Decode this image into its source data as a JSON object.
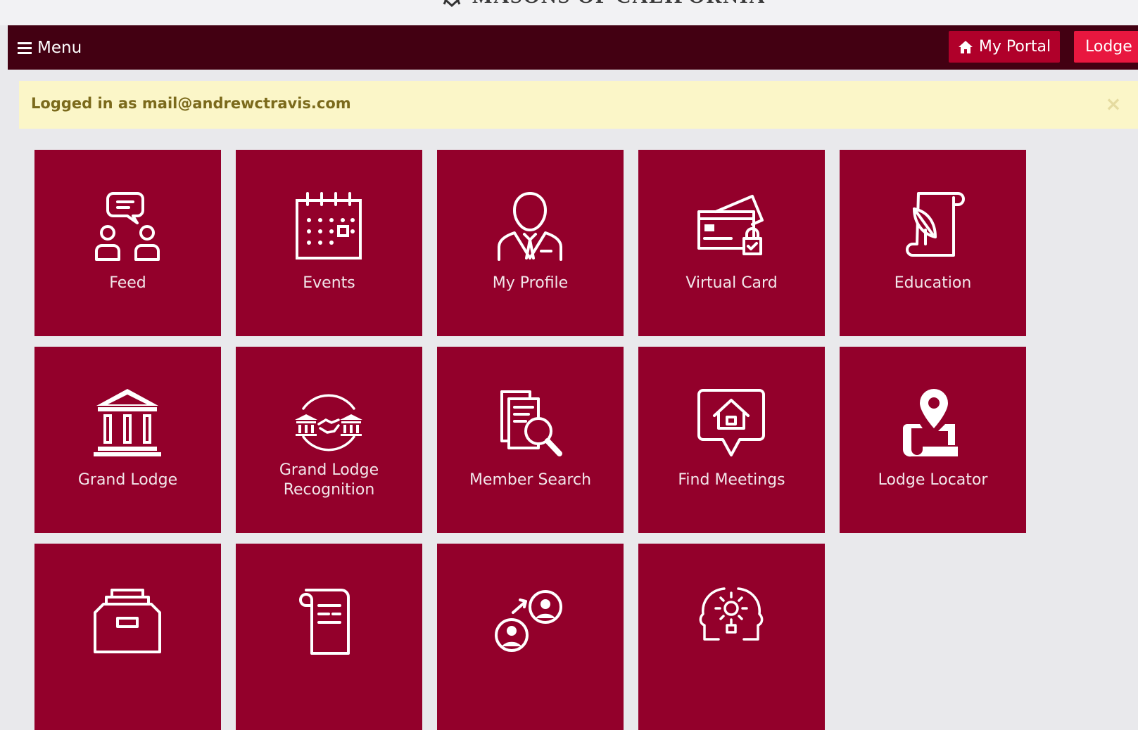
{
  "header": {
    "brand": "MASONS OF CALIFORNIA"
  },
  "navbar": {
    "menu_label": "Menu",
    "portal_label": "My Portal",
    "lodge_label": "Lodge"
  },
  "alert": {
    "message": "Logged in as mail@andrewctravis.com",
    "close_glyph": "×"
  },
  "tiles": [
    {
      "label": "Feed",
      "icon": "feed-chat-icon"
    },
    {
      "label": "Events",
      "icon": "calendar-icon"
    },
    {
      "label": "My Profile",
      "icon": "person-suit-icon"
    },
    {
      "label": "Virtual Card",
      "icon": "card-lock-icon"
    },
    {
      "label": "Education",
      "icon": "scroll-quill-icon"
    },
    {
      "label": "Grand Lodge",
      "icon": "temple-icon"
    },
    {
      "label": "Grand Lodge Recognition",
      "icon": "temple-handshake-icon"
    },
    {
      "label": "Member Search",
      "icon": "document-search-icon"
    },
    {
      "label": "Find Meetings",
      "icon": "house-speech-icon"
    },
    {
      "label": "Lodge Locator",
      "icon": "map-pin-icon"
    },
    {
      "label": "",
      "icon": "archive-box-icon"
    },
    {
      "label": "",
      "icon": "scroll-document-icon"
    },
    {
      "label": "",
      "icon": "people-exchange-icon"
    },
    {
      "label": "",
      "icon": "head-lightbulb-icon"
    }
  ],
  "colors": {
    "navbar": "#430012",
    "tile": "#93002b",
    "portal_button": "#b0002a",
    "lodge_button": "#e8173f",
    "alert_bg": "#fbf6c8",
    "alert_text": "#7b6a1c"
  }
}
